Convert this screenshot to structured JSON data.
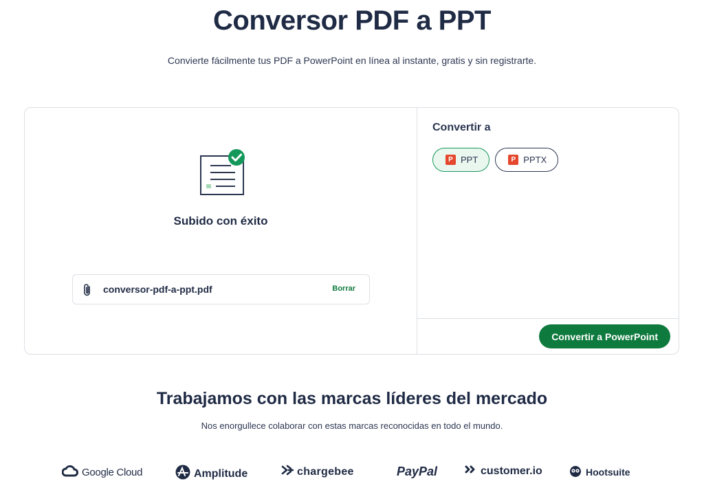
{
  "header": {
    "title": "Conversor PDF a PPT",
    "subtitle": "Convierte fácilmente tus PDF a PowerPoint en línea al instante, gratis y sin registrarte."
  },
  "upload": {
    "status": "Subido con éxito",
    "file_name": "conversor-pdf-a-ppt.pdf",
    "delete_label": "Borrar"
  },
  "convert": {
    "title": "Convertir a",
    "formats": [
      {
        "label": "PPT",
        "badge": "P",
        "selected": true
      },
      {
        "label": "PPTX",
        "badge": "P",
        "selected": false
      }
    ],
    "button_label": "Convertir a PowerPoint"
  },
  "brands": {
    "title": "Trabajamos con las marcas líderes del mercado",
    "subtitle": "Nos enorgullece colaborar con estas marcas reconocidas en todo el mundo.",
    "logos": [
      {
        "name": "Google Cloud",
        "icon": "cloud-icon"
      },
      {
        "name": "Amplitude",
        "icon": "amplitude-icon"
      },
      {
        "name": "chargebee",
        "icon": "chargebee-icon"
      },
      {
        "name": "PayPal",
        "icon": ""
      },
      {
        "name": "customer.io",
        "icon": "customerio-icon"
      },
      {
        "name": "Hootsuite",
        "icon": "owl-icon"
      }
    ]
  },
  "colors": {
    "primary_green": "#0f7a3e",
    "check_green": "#13985a",
    "text_dark": "#1f2a44",
    "ppt_red": "#e4472c",
    "border": "#dcdfe4"
  }
}
